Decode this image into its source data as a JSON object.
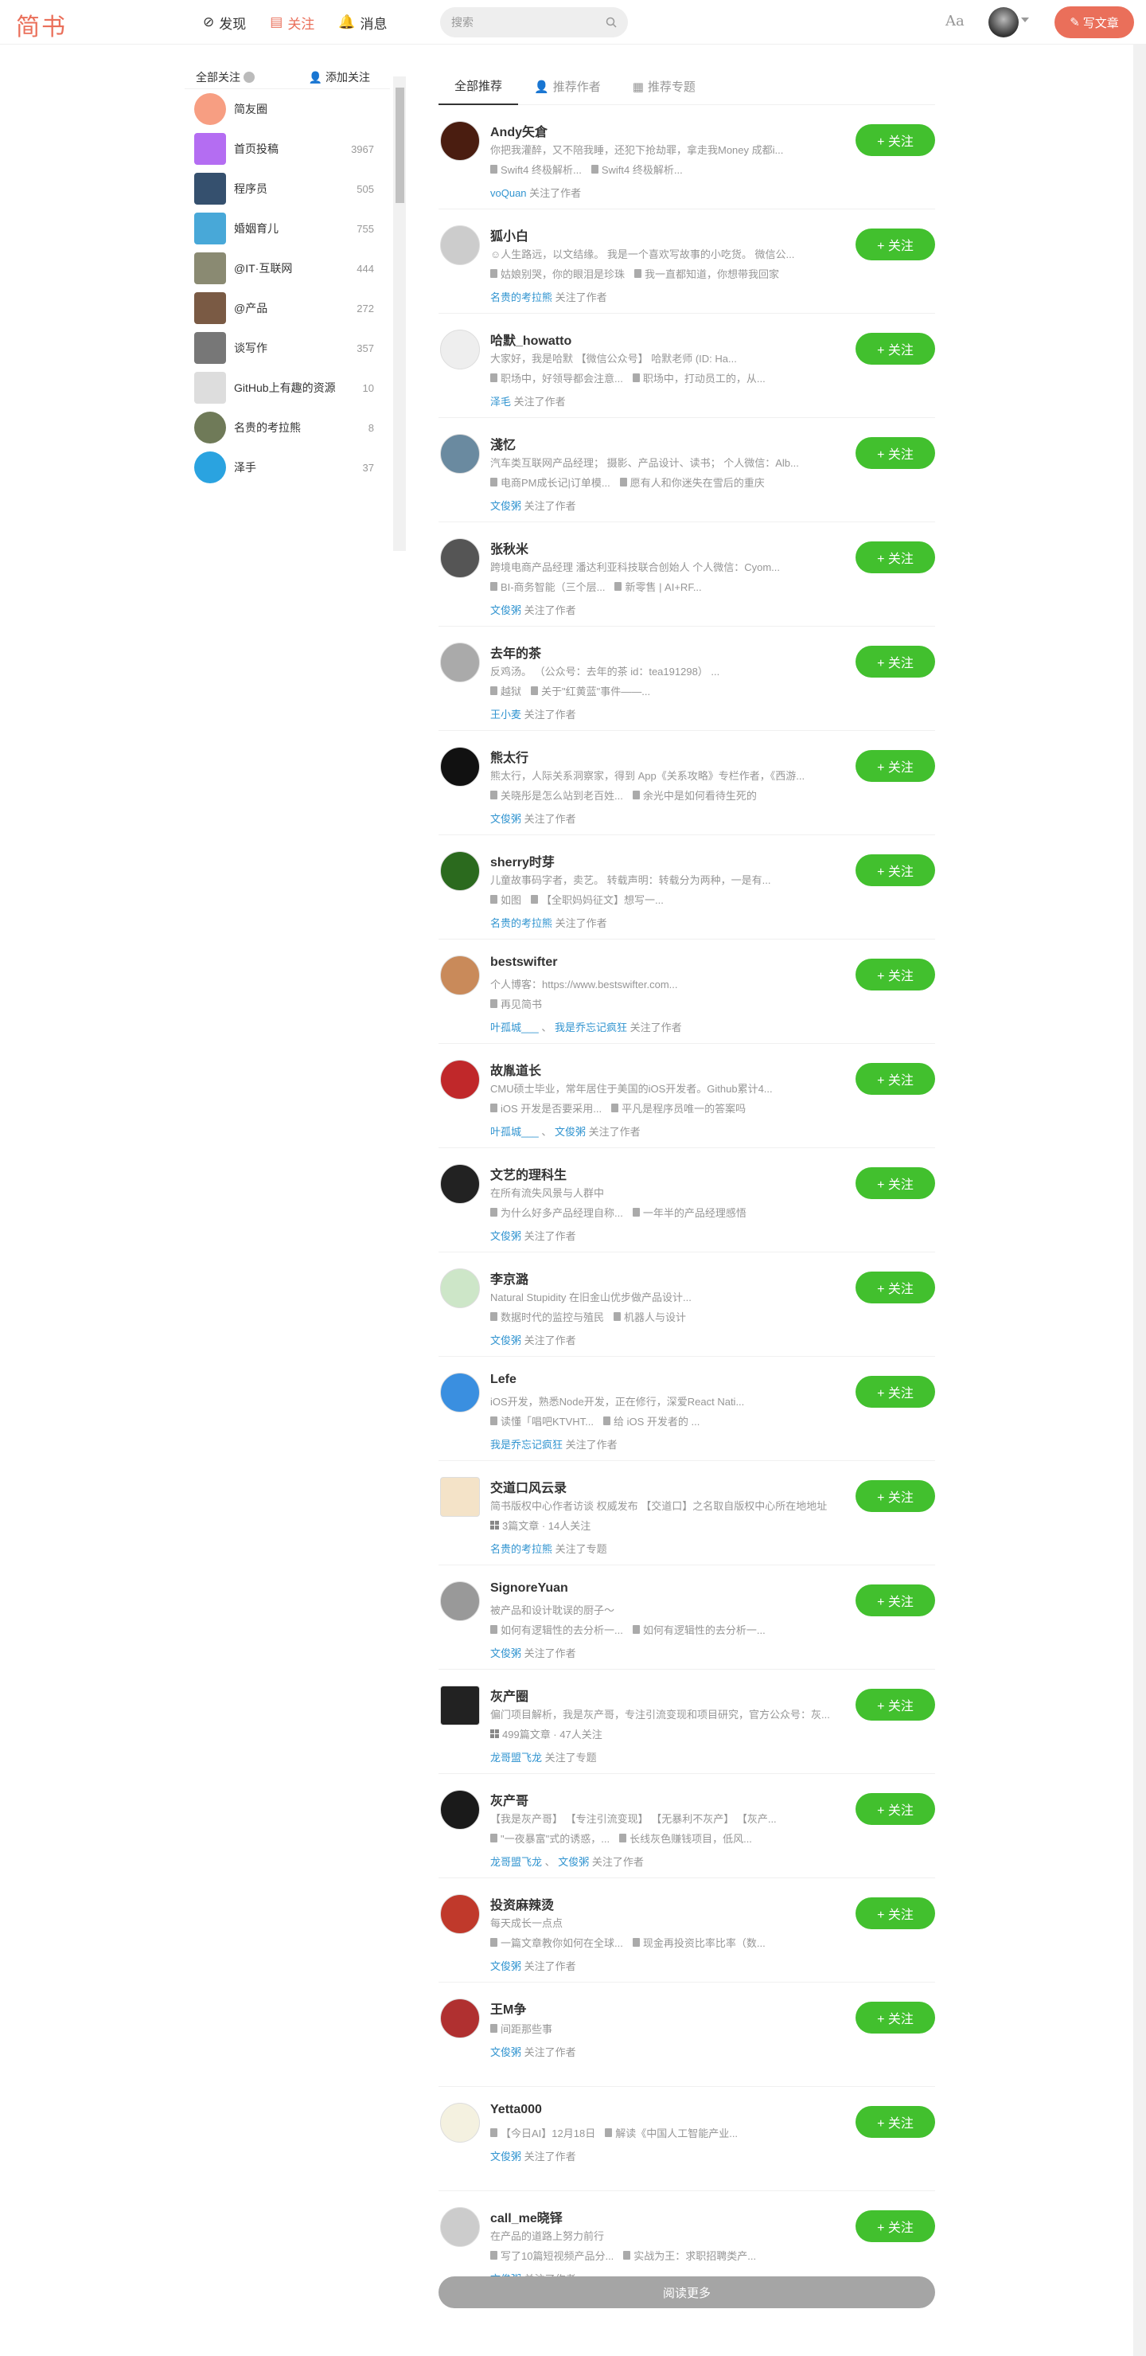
{
  "header": {
    "logo": "简书",
    "nav": [
      {
        "label": "发现",
        "icon": "compass-icon"
      },
      {
        "label": "关注",
        "icon": "follow-icon",
        "active": true
      },
      {
        "label": "消息",
        "icon": "bell-icon"
      }
    ],
    "search_placeholder": "搜索",
    "aa": "Aa",
    "write": "写文章"
  },
  "colors": {
    "brand": "#ea6f5a",
    "follow": "#42c02e",
    "link": "#3194d0"
  },
  "sidebar": {
    "title": "全部关注",
    "add": "添加关注",
    "items": [
      {
        "name": "简友圈",
        "count": "",
        "color": "#f79e82",
        "round": true
      },
      {
        "name": "首页投稿",
        "count": "3967",
        "color": "#b46df2"
      },
      {
        "name": "程序员",
        "count": "505",
        "color": "#35506e"
      },
      {
        "name": "婚姻育儿",
        "count": "755",
        "color": "#48a8d8"
      },
      {
        "name": "@IT·互联网",
        "count": "444",
        "color": "#8a8a72"
      },
      {
        "name": "@产品",
        "count": "272",
        "color": "#7a5a44"
      },
      {
        "name": "谈写作",
        "count": "357",
        "color": "#777"
      },
      {
        "name": "GitHub上有趣的资源",
        "count": "10",
        "color": "#ddd"
      },
      {
        "name": "名贵的考拉熊",
        "count": "8",
        "color": "#6f7a58",
        "round": true
      },
      {
        "name": "泽手",
        "count": "37",
        "color": "#2aa3e0",
        "round": true
      }
    ]
  },
  "tabs": [
    {
      "label": "全部推荐",
      "active": true
    },
    {
      "label": "推荐作者"
    },
    {
      "label": "推荐专题"
    }
  ],
  "follow_label": "+ 关注",
  "feed": [
    {
      "name": "Andy矢倉",
      "desc": "你把我灌醉，又不陪我睡，还犯下抢劫罪，拿走我Money 成都i...",
      "arts": [
        "Swift4 终极解析...",
        "Swift4 终极解析..."
      ],
      "by": [
        "voQuan"
      ],
      "action": "关注了作者",
      "color": "#4a1d10"
    },
    {
      "name": "狐小白",
      "desc": "☺人生路远，以文结缘。 我是一个喜欢写故事的小吃货。 微信公...",
      "arts": [
        "姑娘别哭，你的眼泪是珍珠",
        "我一直都知道，你想带我回家"
      ],
      "by": [
        "名贵的考拉熊"
      ],
      "action": "关注了作者",
      "color": "#ccc"
    },
    {
      "name": "哈默_howatto",
      "desc": "大家好，我是哈默 【微信公众号】 哈默老师 (ID: Ha...",
      "arts": [
        "职场中，好领导都会注意...",
        "职场中，打动员工的，从..."
      ],
      "by": [
        "泽毛"
      ],
      "action": "关注了作者",
      "color": "#eee"
    },
    {
      "name": "淺忆",
      "desc": "汽车类互联网产品经理； 摄影、产品设计、读书； 个人微信：Alb...",
      "arts": [
        "电商PM成长记|订单模...",
        "愿有人和你迷失在雪后的重庆"
      ],
      "by": [
        "文俊粥"
      ],
      "action": "关注了作者",
      "color": "#6a8aa0"
    },
    {
      "name": "张秋米",
      "desc": "跨境电商产品经理 潘达利亚科技联合创始人 个人微信：Cyom...",
      "arts": [
        "BI-商务智能（三个层...",
        "新零售 | AI+RF..."
      ],
      "by": [
        "文俊粥"
      ],
      "action": "关注了作者",
      "color": "#555"
    },
    {
      "name": "去年的茶",
      "desc": "反鸡汤。 （公众号：去年的茶 id：tea191298） ...",
      "arts": [
        "越狱",
        "关于\"红黄蓝\"事件——..."
      ],
      "by": [
        "王小麦"
      ],
      "action": "关注了作者",
      "color": "#aaa"
    },
    {
      "name": "熊太行",
      "desc": "熊太行，人际关系洞察家，得到 App《关系攻略》专栏作者，《西游...",
      "arts": [
        "关晓彤是怎么站到老百姓...",
        "余光中是如何看待生死的"
      ],
      "by": [
        "文俊粥"
      ],
      "action": "关注了作者",
      "color": "#111"
    },
    {
      "name": "sherry时芽",
      "desc": "儿童故事码字者，卖艺。 转载声明：转载分为两种，一是有...",
      "arts": [
        "如图",
        "【全职妈妈征文】想写一..."
      ],
      "by": [
        "名贵的考拉熊"
      ],
      "action": "关注了作者",
      "color": "#2b6a1e"
    },
    {
      "name": "bestswifter",
      "desc": "个人博客：https://www.bestswifter.com...",
      "arts": [
        "再见简书"
      ],
      "by": [
        "叶孤城___",
        "我是乔忘记疯狂"
      ],
      "action": "关注了作者",
      "color": "#c98a5a"
    },
    {
      "name": "故胤道长",
      "desc": "CMU硕士毕业，常年居住于美国的iOS开发者。Github累计4...",
      "arts": [
        "iOS 开发是否要采用...",
        "平凡是程序员唯一的答案吗"
      ],
      "by": [
        "叶孤城___",
        "文俊粥"
      ],
      "action": "关注了作者",
      "color": "#c0282a"
    },
    {
      "name": "文艺的理科生",
      "desc": "在所有流失风景与人群中",
      "arts": [
        "为什么好多产品经理自称...",
        "一年半的产品经理感悟"
      ],
      "by": [
        "文俊粥"
      ],
      "action": "关注了作者",
      "color": "#222"
    },
    {
      "name": "李京潞",
      "desc": "Natural Stupidity 在旧金山优步做产品设计...",
      "arts": [
        "数据时代的监控与殖民",
        "机器人与设计"
      ],
      "by": [
        "文俊粥"
      ],
      "action": "关注了作者",
      "color": "#cde6c8"
    },
    {
      "name": "Lefe",
      "desc": "iOS开发，熟悉Node开发，正在修行，深爱React Nati...",
      "arts": [
        "读懂「唱吧KTVHT...",
        "给 iOS 开发者的 ..."
      ],
      "by": [
        "我是乔忘记疯狂"
      ],
      "action": "关注了作者",
      "color": "#3a8fe0"
    },
    {
      "name": "交道口风云录",
      "desc": "简书版权中心作者访谈 权威发布 【交道口】之名取自版权中心所在地地址",
      "stats": "3篇文章 · 14人关注",
      "by": [
        "名贵的考拉熊"
      ],
      "action": "关注了专题",
      "color": "#f4e3c8",
      "square": true
    },
    {
      "name": "SignoreYuan",
      "desc": "被产品和设计耽误的厨子～",
      "arts": [
        "如何有逻辑性的去分析一...",
        "如何有逻辑性的去分析一..."
      ],
      "by": [
        "文俊粥"
      ],
      "action": "关注了作者",
      "color": "#999"
    },
    {
      "name": "灰产圈",
      "desc": "偏门项目解析，我是灰产哥，专注引流变现和项目研究，官方公众号：灰...",
      "stats": "499篇文章 · 47人关注",
      "by": [
        "龙哥盟飞龙"
      ],
      "action": "关注了专题",
      "color": "#222",
      "square": true
    },
    {
      "name": "灰产哥",
      "desc": "【我是灰产哥】 【专注引流变现】 【无暴利不灰产】 【灰产...",
      "arts": [
        "\"一夜暴富\"式的诱惑，...",
        "长线灰色赚钱项目，低风..."
      ],
      "by": [
        "龙哥盟飞龙",
        "文俊粥"
      ],
      "action": "关注了作者",
      "color": "#1a1a1a"
    },
    {
      "name": "投资麻辣烫",
      "desc": "每天成长一点点",
      "arts": [
        "一篇文章教你如何在全球...",
        "现金再投资比率比率（数..."
      ],
      "by": [
        "文俊粥"
      ],
      "action": "关注了作者",
      "color": "#c0392b"
    },
    {
      "name": "王M争",
      "desc": "",
      "arts": [
        "间距那些事"
      ],
      "by": [
        "文俊粥"
      ],
      "action": "关注了作者",
      "color": "#b03030"
    },
    {
      "name": "Yetta000",
      "desc": "",
      "arts": [
        "【今日AI】12月18日",
        "解读《中国人工智能产业..."
      ],
      "by": [
        "文俊粥"
      ],
      "action": "关注了作者",
      "color": "#f4f1e0"
    },
    {
      "name": "call_me晓铎",
      "desc": "在产品的道路上努力前行",
      "arts": [
        "写了10篇短视频产品分...",
        "实战为王：求职招聘类产..."
      ],
      "by": [
        "文俊粥"
      ],
      "action": "关注了作者",
      "color": "#ccc"
    }
  ],
  "load_more": "阅读更多"
}
